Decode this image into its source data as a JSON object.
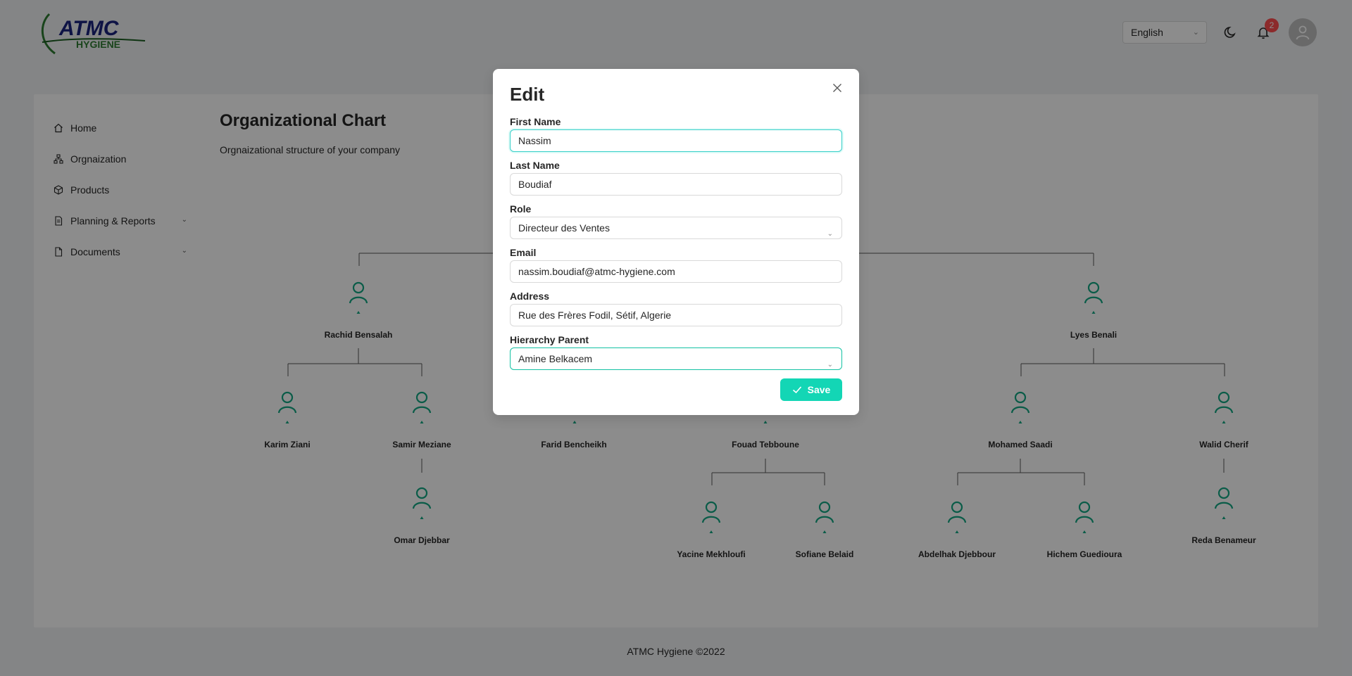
{
  "header": {
    "logo_text_top": "ATMC",
    "logo_text_bottom": "HYGIENE",
    "language": "English",
    "notification_count": "2"
  },
  "sidebar": {
    "items": [
      {
        "label": "Home",
        "icon": "home-icon"
      },
      {
        "label": "Orgnaization",
        "icon": "org-icon"
      },
      {
        "label": "Products",
        "icon": "box-icon"
      },
      {
        "label": "Planning & Reports",
        "icon": "file-icon",
        "expandable": true
      },
      {
        "label": "Documents",
        "icon": "document-icon",
        "expandable": true
      }
    ]
  },
  "page": {
    "title": "Organizational Chart",
    "subtitle": "Orgnaizational structure of your company"
  },
  "org": {
    "nodes": [
      {
        "name": "Rachid Bensalah"
      },
      {
        "name": "Lyes Benali"
      },
      {
        "name": "Karim Ziani"
      },
      {
        "name": "Samir Meziane"
      },
      {
        "name": "Farid Bencheikh"
      },
      {
        "name": "Fouad Tebboune"
      },
      {
        "name": "Mohamed Saadi"
      },
      {
        "name": "Walid Cherif"
      },
      {
        "name": "Omar Djebbar"
      },
      {
        "name": "Yacine Mekhloufi"
      },
      {
        "name": "Sofiane Belaid"
      },
      {
        "name": "Abdelhak Djebbour"
      },
      {
        "name": "Hichem Guedioura"
      },
      {
        "name": "Reda Benameur"
      }
    ],
    "accent_color": "#13a883"
  },
  "footer": {
    "text": "ATMC Hygiene ©2022"
  },
  "modal": {
    "title": "Edit",
    "first_name_label": "First Name",
    "first_name_value": "Nassim",
    "last_name_label": "Last Name",
    "last_name_value": "Boudiaf",
    "role_label": "Role",
    "role_value": "Directeur des Ventes",
    "email_label": "Email",
    "email_value": "nassim.boudiaf@atmc-hygiene.com",
    "address_label": "Address",
    "address_value": "Rue des Frères Fodil, Sétif, Algerie",
    "parent_label": "Hierarchy Parent",
    "parent_value": "Amine Belkacem",
    "save_label": "Save",
    "accent_color": "#13d6b5"
  }
}
